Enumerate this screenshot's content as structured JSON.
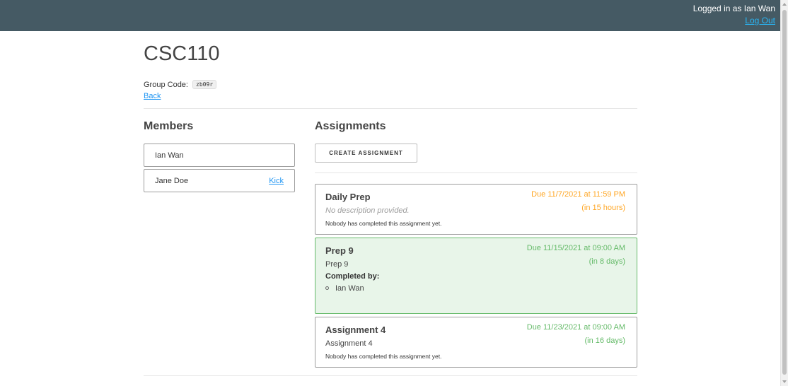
{
  "header": {
    "user_text": "Logged in as Ian Wan",
    "logout_label": "Log Out"
  },
  "page": {
    "title": "CSC110",
    "group_code_label": "Group Code:",
    "group_code": "zb09r",
    "back_label": "Back"
  },
  "members": {
    "heading": "Members",
    "items": [
      {
        "name": "Ian Wan",
        "action": ""
      },
      {
        "name": "Jane Doe",
        "action": "Kick"
      }
    ]
  },
  "assignments": {
    "heading": "Assignments",
    "create_label": "CREATE ASSIGNMENT",
    "items": [
      {
        "title": "Daily Prep",
        "description": "No description provided.",
        "due": "Due 11/7/2021 at 11:59 PM",
        "relative": "(in 15 hours)",
        "status": "Nobody has completed this assignment yet.",
        "completed_label": "",
        "completed_by": []
      },
      {
        "title": "Prep 9",
        "description": "Prep 9",
        "due": "Due 11/15/2021 at 09:00 AM",
        "relative": "(in 8 days)",
        "status": "",
        "completed_label": "Completed by:",
        "completed_by": [
          "Ian Wan"
        ]
      },
      {
        "title": "Assignment 4",
        "description": "Assignment 4",
        "due": "Due 11/23/2021 at 09:00 AM",
        "relative": "(in 16 days)",
        "status": "Nobody has completed this assignment yet.",
        "completed_label": "",
        "completed_by": []
      }
    ]
  },
  "colors": {
    "topbar": "#455a64",
    "link": "#2196f3",
    "due_soon": "#ffa726",
    "due_later": "#66bb6a",
    "completed_bg": "#e8f5e9"
  }
}
